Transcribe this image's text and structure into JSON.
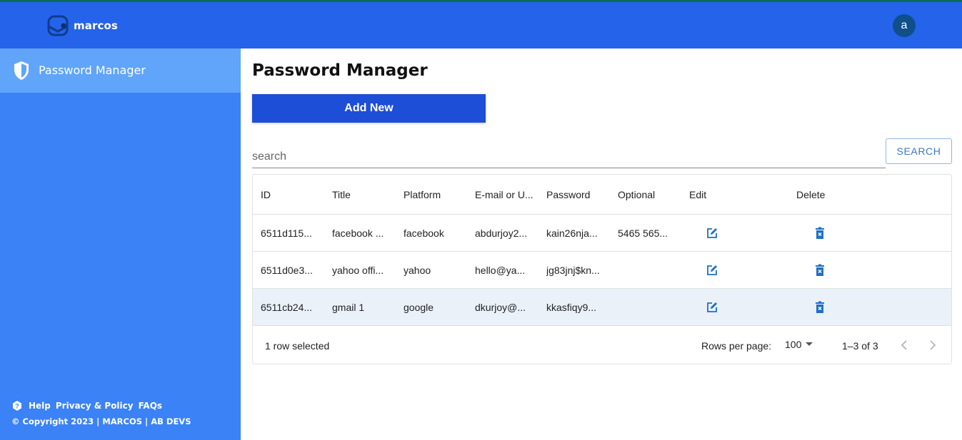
{
  "header": {
    "brand": "marcos",
    "avatar_letter": "a",
    "brand_color": "#2563eb"
  },
  "sidebar": {
    "active_item": {
      "label": "Password Manager",
      "icon": "shield-icon"
    },
    "footer_links": [
      "Help",
      "Privacy & Policy",
      "FAQs"
    ],
    "copyright": "© Copyright 2023 | MARCOS | AB DEVS"
  },
  "main": {
    "title": "Password Manager",
    "add_button": "Add New",
    "search": {
      "placeholder": "search",
      "value": "",
      "button": "SEARCH"
    }
  },
  "table": {
    "columns": [
      "ID",
      "Title",
      "Platform",
      "E-mail or U...",
      "Password",
      "Optional",
      "Edit",
      "Delete"
    ],
    "rows": [
      {
        "id": "6511d115...",
        "title": "facebook ...",
        "platform": "facebook",
        "email": "abdurjoy2...",
        "password": "kain26nja...",
        "optional": "5465 565...",
        "selected": false
      },
      {
        "id": "6511d0e3...",
        "title": "yahoo offi...",
        "platform": "yahoo",
        "email": "hello@ya...",
        "password": "jg83jnj$kn...",
        "optional": "",
        "selected": false
      },
      {
        "id": "6511cb24...",
        "title": "gmail 1",
        "platform": "google",
        "email": "dkurjoy@...",
        "password": "kkasfiqy9...",
        "optional": "",
        "selected": true
      }
    ],
    "footer": {
      "selection": "1 row selected",
      "rows_per_page_label": "Rows per page:",
      "rows_per_page": "100",
      "range": "1–3 of 3"
    }
  }
}
